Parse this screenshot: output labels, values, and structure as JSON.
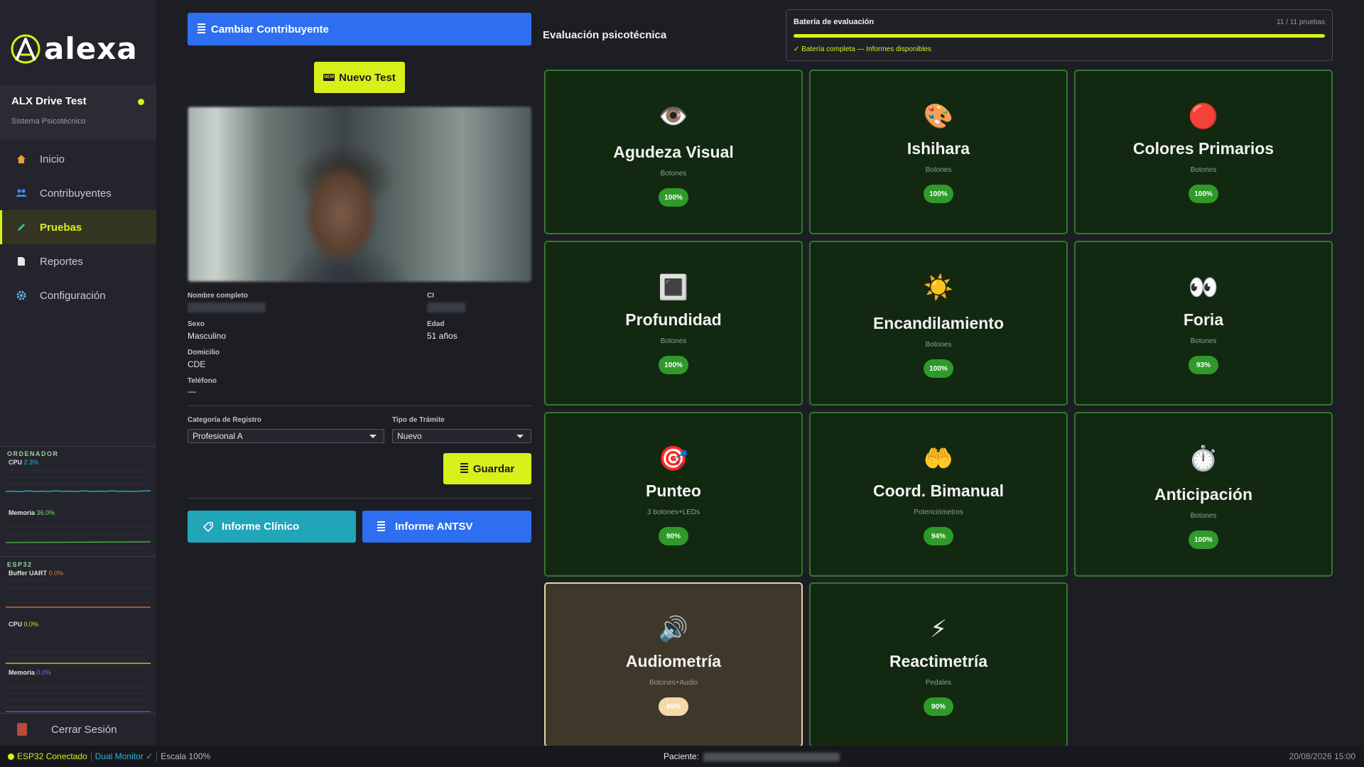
{
  "sidebar": {
    "logo_text": "alexa",
    "app_name": "ALX Drive Test",
    "app_subtitle": "Sistema Psicotécnico",
    "items": [
      {
        "label": "Inicio",
        "icon": "home-icon"
      },
      {
        "label": "Contribuyentes",
        "icon": "users-icon"
      },
      {
        "label": "Pruebas",
        "icon": "pencil-icon",
        "active": true
      },
      {
        "label": "Reportes",
        "icon": "document-icon"
      },
      {
        "label": "Configuración",
        "icon": "gear-icon"
      }
    ],
    "monitor": {
      "computer_label": "ORDENADOR",
      "cpu_label": "CPU",
      "cpu_value": "2.3%",
      "memory_label": "Memoria",
      "memory_value": "36.0%",
      "esp_label": "ESP32",
      "buffer_label": "Buffer UART",
      "buffer_value": "0.0%",
      "esp_cpu_label": "CPU",
      "esp_cpu_value": "0.0%",
      "esp_memory_label": "Memoria",
      "esp_memory_value": "0.0%"
    },
    "logout_label": "Cerrar Sesión"
  },
  "actions": {
    "change_label": "Cambiar Contribuyente",
    "new_test_badge": "NEW",
    "new_test_label": "Nuevo Test",
    "save_label": "Guardar",
    "clinical_report_label": "Informe Clínico",
    "antsv_report_label": "Informe ANTSV"
  },
  "profile": {
    "name_label": "Nombre completo",
    "ci_label": "CI",
    "sex_label": "Sexo",
    "sex_value": "Masculino",
    "age_label": "Edad",
    "age_value": "51 años",
    "address_label": "Domicilio",
    "address_value": "CDE",
    "phone_label": "Teléfono",
    "phone_value": "—"
  },
  "form": {
    "category_label": "Categoría de Registro",
    "category_value": "Profesional A",
    "procedure_label": "Tipo de Trámite",
    "procedure_value": "Nuevo"
  },
  "evaluation": {
    "title": "Evaluación psicotécnica",
    "battery_title": "Batería de evaluación",
    "battery_count": "11 / 11 pruebas",
    "battery_progress": 1.0,
    "battery_status": "✓ Batería completa — Informes disponibles",
    "tests": [
      {
        "name": "Agudeza Visual",
        "icon": "👁️",
        "input": "Botones",
        "score": "100%"
      },
      {
        "name": "Ishihara",
        "icon": "🎨",
        "input": "Botones",
        "score": "100%"
      },
      {
        "name": "Colores Primarios",
        "icon": "🔴",
        "input": "Botones",
        "score": "100%"
      },
      {
        "name": "Profundidad",
        "icon": "🔳",
        "input": "Botones",
        "score": "100%"
      },
      {
        "name": "Encandilamiento",
        "icon": "☀️",
        "input": "Botones",
        "score": "100%"
      },
      {
        "name": "Foria",
        "icon": "👀",
        "input": "Botones",
        "score": "93%"
      },
      {
        "name": "Punteo",
        "icon": "🎯",
        "input": "3 botones+LEDs",
        "score": "90%"
      },
      {
        "name": "Coord. Bimanual",
        "icon": "🤲",
        "input": "Potenciómetros",
        "score": "94%"
      },
      {
        "name": "Anticipación",
        "icon": "⏱️",
        "input": "Botones",
        "score": "100%"
      },
      {
        "name": "Audiometría",
        "icon": "🔊",
        "input": "Botones+Audio",
        "score": "65%",
        "warning": true
      },
      {
        "name": "Reactimetría",
        "icon": "⚡",
        "input": "Pedales",
        "score": "90%"
      }
    ]
  },
  "statusbar": {
    "esp_status": "ESP32 Conectado",
    "dual_monitor": "Dual Monitor ✓",
    "scale": "Escala 100%",
    "patient_label": "Paciente:",
    "datetime": "20/08/2026 15:00"
  },
  "colors": {
    "accent": "#d8f01a",
    "primary_blue": "#2d6ff0",
    "teal": "#21a5b8",
    "card_bg": "#122810",
    "card_border": "#2f7a2a",
    "warning_card_bg": "#40372b"
  }
}
